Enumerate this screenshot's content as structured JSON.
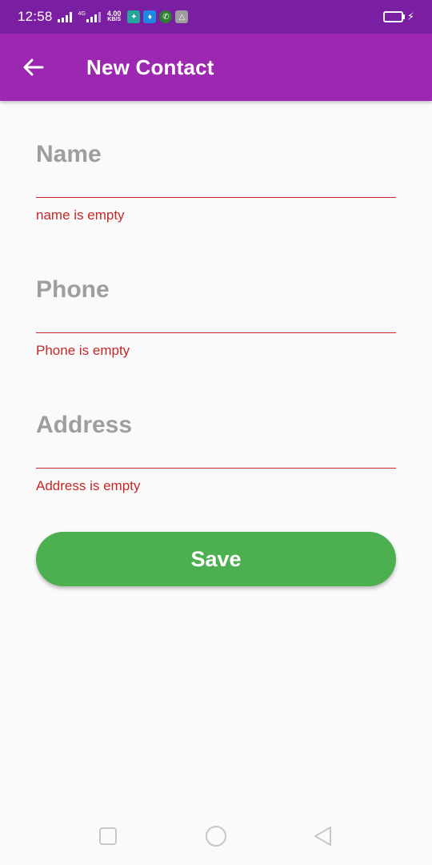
{
  "status_bar": {
    "time": "12:58",
    "network_type": "4G",
    "speed_value": "4.00",
    "speed_unit": "KB/S",
    "icons": [
      "app-icon",
      "app-icon",
      "whatsapp-icon",
      "drive-icon"
    ]
  },
  "app_bar": {
    "title": "New Contact",
    "back_icon": "arrow-back-icon"
  },
  "form": {
    "name": {
      "placeholder": "Name",
      "value": "",
      "error": "name is empty"
    },
    "phone": {
      "placeholder": "Phone",
      "value": "",
      "error": "Phone is empty"
    },
    "address": {
      "placeholder": "Address",
      "value": "",
      "error": "Address is empty"
    }
  },
  "save_label": "Save",
  "colors": {
    "status_bar": "#7b1fa2",
    "app_bar": "#9c27b0",
    "error": "#c62828",
    "save_button": "#4caf50",
    "placeholder": "#9e9e9e"
  },
  "nav_bar": {
    "icons": [
      "recent-apps-icon",
      "home-icon",
      "back-icon"
    ]
  }
}
